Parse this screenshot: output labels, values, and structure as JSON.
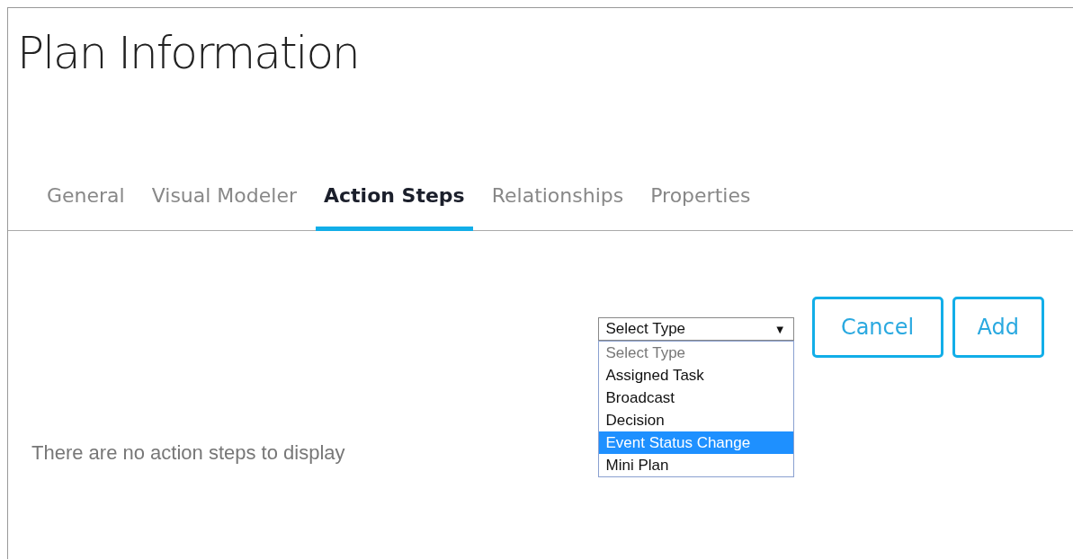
{
  "title": "Plan Information",
  "tabs": [
    {
      "label": "General",
      "selected": false
    },
    {
      "label": "Visual Modeler",
      "selected": false
    },
    {
      "label": "Action Steps",
      "selected": true
    },
    {
      "label": "Relationships",
      "selected": false
    },
    {
      "label": "Properties",
      "selected": false
    }
  ],
  "empty_message": "There are no action steps to display",
  "type_select": {
    "value": "Select Type",
    "caret": "▼",
    "options": [
      {
        "label": "Select Type",
        "kind": "placeholder",
        "highlighted": false
      },
      {
        "label": "Assigned Task",
        "kind": "option",
        "highlighted": false
      },
      {
        "label": "Broadcast",
        "kind": "option",
        "highlighted": false
      },
      {
        "label": "Decision",
        "kind": "option",
        "highlighted": false
      },
      {
        "label": "Event Status Change",
        "kind": "option",
        "highlighted": true
      },
      {
        "label": "Mini Plan",
        "kind": "option",
        "highlighted": false
      }
    ]
  },
  "buttons": [
    "Cancel",
    "Add"
  ]
}
